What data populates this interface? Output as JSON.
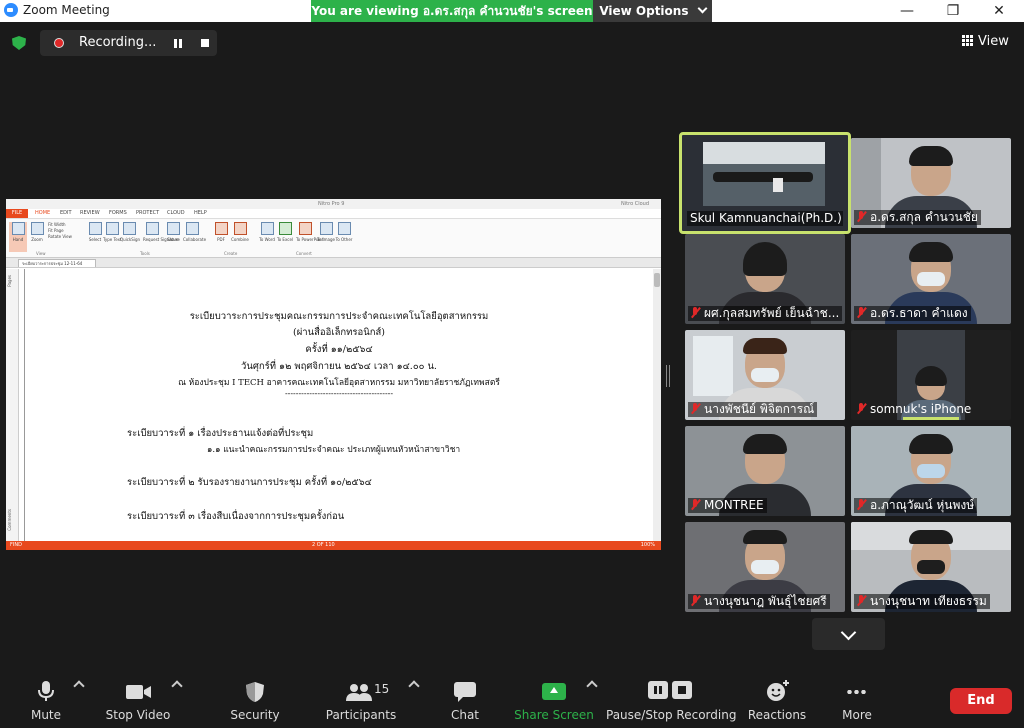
{
  "window": {
    "title": "Zoom Meeting",
    "viewing_banner": "You are viewing อ.ดร.สกุล  คำนวนชัย's screen",
    "view_options": "View Options",
    "minimize": "—",
    "maximize": "❐",
    "close": "✕"
  },
  "meeting_bar": {
    "recording_label": "Recording...",
    "view_label": "View"
  },
  "shared_screen": {
    "app_title": "Nitro Pro 9",
    "user": "Nitro Cloud",
    "file_tab": "FILE",
    "ribbon_tabs": [
      "HOME",
      "EDIT",
      "REVIEW",
      "FORMS",
      "PROTECT",
      "CLOUD",
      "HELP"
    ],
    "ribbon_buttons": [
      "Hand",
      "Zoom",
      "Fit Width",
      "Fit Page",
      "Rotate View",
      "Select",
      "Type Text",
      "QuickSign",
      "Request Signature",
      "Share",
      "Collaborate",
      "PDF",
      "Combine",
      "To Word",
      "To Excel",
      "To PowerPoint",
      "To Image",
      "To Other"
    ],
    "ribbon_groups": [
      "View",
      "Tools",
      "Create",
      "Convert"
    ],
    "doc_tab": "ระเบียบวาระการประชุม 12-11-64",
    "side_labels": [
      "Pages",
      "Comments"
    ],
    "doc_lines": {
      "title1": "ระเบียบวาระการประชุมคณะกรรมการประจำคณะเทคโนโลยีอุตสาหกรรม",
      "title2": "(ผ่านสื่ออิเล็กทรอนิกส์)",
      "title3": "ครั้งที่ ๑๑/๒๕๖๔",
      "title4": "วันศุกร์ที่  ๑๒  พฤศจิกายน  ๒๕๖๔   เวลา  ๑๔.๐๐  น.",
      "title5": "ณ ห้องประชุม I TECH  อาคารคณะเทคโนโลยีอุตสาหกรรม  มหาวิทยาลัยราชภัฏเทพสตรี",
      "divider": "----------------------------------------",
      "agenda1": "ระเบียบวาระที่  ๑  เรื่องประธานแจ้งต่อที่ประชุม",
      "agenda1_1": "๑.๑ แนะนำคณะกรรมการประจำคณะ ประเภทผู้แทนหัวหน้าสาขาวิชา",
      "agenda2": "ระเบียบวาระที่  ๒  รับรองรายงานการประชุม  ครั้งที่ ๑๐/๒๕๖๔",
      "agenda3": "ระเบียบวาระที่  ๓  เรื่องสืบเนื่องจากการประชุมครั้งก่อน"
    },
    "status_left": "FIND",
    "status_page": "2 OF 110",
    "status_zoom": "100%"
  },
  "participants_tiles": [
    {
      "name": "Skul Kamnuanchai(Ph.D.)",
      "muted": false,
      "active": true
    },
    {
      "name": "อ.ดร.สกุล  คำนวนชัย",
      "muted": true,
      "active": false
    },
    {
      "name": "ผศ.กุลสมทรัพย์  เย็นฉ่ำช...",
      "muted": true,
      "active": false
    },
    {
      "name": "อ.ดร.ธาดา  คำแดง",
      "muted": true,
      "active": false
    },
    {
      "name": "นางพัชนีย์  พิจิตการณ์",
      "muted": true,
      "active": false
    },
    {
      "name": "somnuk's iPhone",
      "muted": true,
      "active": false
    },
    {
      "name": "MONTREE",
      "muted": true,
      "active": false
    },
    {
      "name": "อ.ภาณุวัฒน์  หุ่นพงษ์",
      "muted": true,
      "active": false
    },
    {
      "name": "นางนุชนาฎ  พันธุ์ไชยศรี",
      "muted": true,
      "active": false
    },
    {
      "name": "นางนุชนาท  เที่ยงธรรม",
      "muted": true,
      "active": false
    }
  ],
  "toolbar": {
    "mute": "Mute",
    "stop_video": "Stop Video",
    "security": "Security",
    "participants": "Participants",
    "participants_count": "15",
    "chat": "Chat",
    "share_screen": "Share Screen",
    "pause_stop_recording": "Pause/Stop Recording",
    "reactions": "Reactions",
    "more": "More",
    "end": "End"
  },
  "colors": {
    "banner_green": "#2db24a",
    "end_red": "#d92a2a",
    "active_speaker": "#c8e26d",
    "nitro_orange": "#e8491e"
  }
}
